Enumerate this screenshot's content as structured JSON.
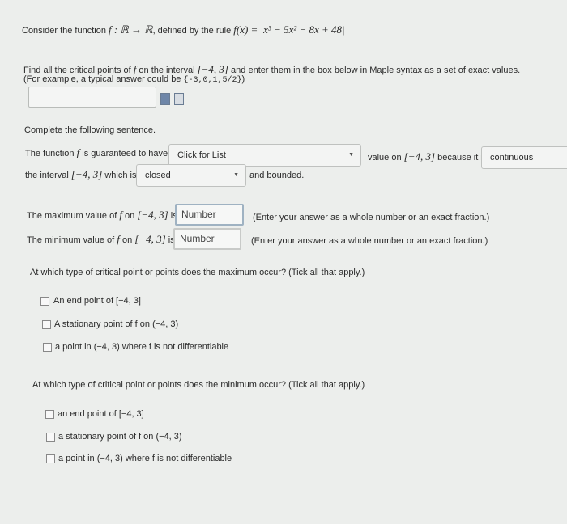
{
  "intro": {
    "text1": "Consider the function",
    "sig": "f : ℝ → ℝ",
    "text2": ", defined by the rule",
    "rule": "f(x) = |x³ − 5x² − 8x + 48|"
  },
  "q1": {
    "line1_a": "Find all the critical points of",
    "f": "f",
    "line1_b": "on the interval",
    "interval": "[−4, 3]",
    "line1_c": "and enter them in the box below in Maple syntax as a set of exact values.",
    "line2_a": "(For example, a typical answer could be",
    "example": "{-3,0,1,5/2}",
    "line2_b": ")",
    "answer_value": "",
    "icons": [
      "maple-syntax-icon",
      "preview-icon"
    ]
  },
  "sentence": {
    "heading": "Complete the following sentence.",
    "p1": "The function",
    "f": "f",
    "p2": "is guaranteed to have",
    "select1": "Click for List",
    "p3": "value on",
    "interval": "[−4, 3]",
    "p4": "because it is",
    "select2": "continuous",
    "p5": "the interval",
    "p6": "which is",
    "select3": "closed",
    "p7": "and bounded."
  },
  "values": {
    "max_label_a": "The maximum value of",
    "min_label_a": "The minimum value of",
    "f": "f",
    "on": "on",
    "interval": "[−4, 3]",
    "is": "is",
    "max_placeholder": "Number",
    "min_placeholder": "Number",
    "hint": "(Enter your answer as a whole number or an exact fraction.)"
  },
  "max_q": {
    "question": "At which type of critical point or points does the maximum occur? (Tick all that apply.)",
    "options": [
      "An end point of [−4, 3]",
      "A stationary point of f on (−4, 3)",
      "a point in (−4, 3) where f is not differentiable"
    ]
  },
  "min_q": {
    "question": "At which type of critical point or points does the minimum occur? (Tick all that apply.)",
    "options": [
      "an end point of [−4, 3]",
      "a stationary point of f on (−4, 3)",
      "a point in (−4, 3) where f is not differentiable"
    ]
  }
}
